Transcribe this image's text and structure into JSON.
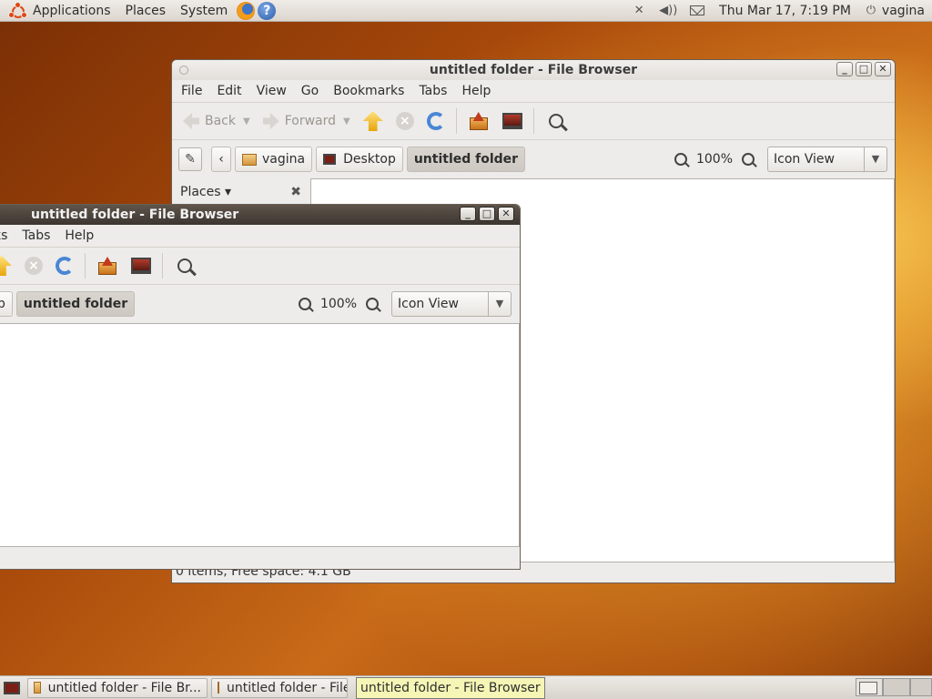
{
  "top_panel": {
    "menus": [
      "Applications",
      "Places",
      "System"
    ],
    "clock": "Thu Mar 17,  7:19 PM",
    "user": "vagina"
  },
  "window_back": {
    "title": "untitled folder - File Browser",
    "menu": [
      "File",
      "Edit",
      "View",
      "Go",
      "Bookmarks",
      "Tabs",
      "Help"
    ],
    "toolbar": {
      "back": "Back",
      "forward": "Forward"
    },
    "path": [
      "vagina",
      "Desktop",
      "untitled folder"
    ],
    "zoom": "100%",
    "view_mode": "Icon View",
    "sidebar_label": "Places",
    "status": "0 items, Free space: 4.1 GB"
  },
  "window_front": {
    "title": "untitled folder - File Browser",
    "menu": [
      "ks",
      "Tabs",
      "Help"
    ],
    "path_partial": "p",
    "path_current": "untitled folder",
    "zoom": "100%",
    "view_mode": "Icon View"
  },
  "taskbar": {
    "tasks": [
      "untitled folder - File Br...",
      "untitled folder - File"
    ],
    "tooltip": "untitled folder - File Browser"
  }
}
